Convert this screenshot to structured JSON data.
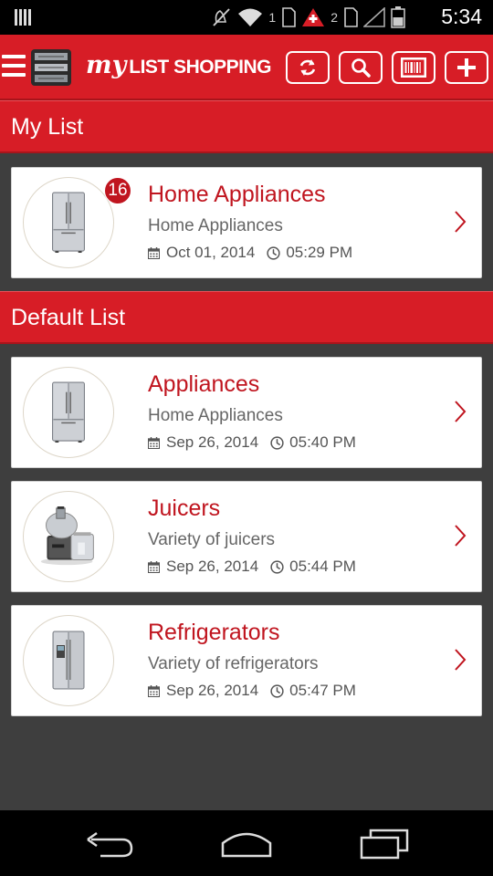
{
  "status_bar": {
    "time": "5:34",
    "sim1_label": "1",
    "sim2_label": "2",
    "icons": [
      "notification-bars-icon",
      "mute-icon",
      "wifi-icon",
      "sim-icon",
      "alert-icon",
      "signal-icon",
      "battery-icon"
    ]
  },
  "header": {
    "brand_script": "my",
    "brand_text": "LIST SHOPPING",
    "accent_color": "#d71d26",
    "buttons": [
      "sync-icon",
      "search-icon",
      "barcode-icon",
      "plus-icon"
    ]
  },
  "sections": {
    "my_list": {
      "title": "My List",
      "items": [
        {
          "title": "Home Appliances",
          "subtitle": "Home Appliances",
          "date": "Oct 01, 2014",
          "time": "05:29 PM",
          "badge": "16",
          "image": "refrigerator-image"
        }
      ]
    },
    "default_list": {
      "title": "Default List",
      "items": [
        {
          "title": "Appliances",
          "subtitle": "Home Appliances",
          "date": "Sep 26, 2014",
          "time": "05:40 PM",
          "image": "refrigerator-image"
        },
        {
          "title": "Juicers",
          "subtitle": "Variety of juicers",
          "date": "Sep 26, 2014",
          "time": "05:44 PM",
          "image": "juicer-image"
        },
        {
          "title": "Refrigerators",
          "subtitle": "Variety of refrigerators",
          "date": "Sep 26, 2014",
          "time": "05:47 PM",
          "image": "side-by-side-refrigerator-image"
        }
      ]
    }
  },
  "nav_bar": {
    "buttons": [
      "back-icon",
      "home-icon",
      "recent-apps-icon"
    ]
  }
}
